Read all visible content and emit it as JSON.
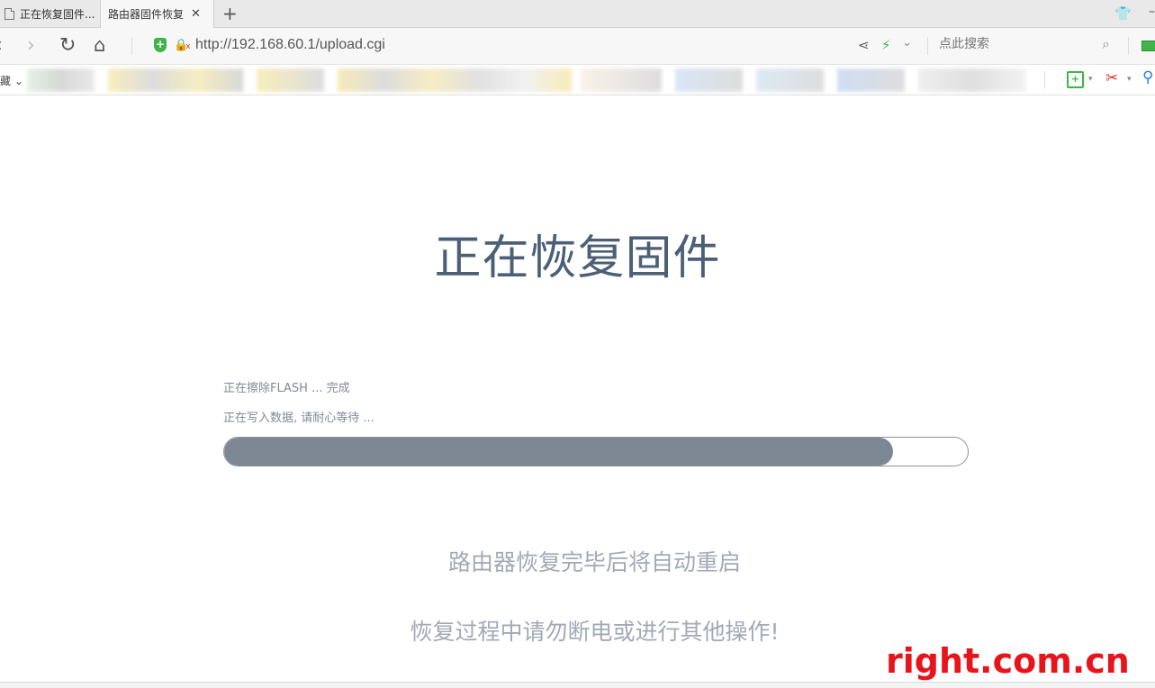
{
  "tabs": [
    {
      "label": "正在恢复固件...",
      "active": false
    },
    {
      "label": "路由器固件恢复",
      "active": true
    }
  ],
  "address_bar": {
    "url": "http://192.168.60.1/upload.cgi",
    "search_placeholder": "点此搜索"
  },
  "bookmarks_bar": {
    "label": "藏 ⌄"
  },
  "main": {
    "heading": "正在恢复固件",
    "status_lines": [
      "正在擦除FLASH ... 完成",
      "正在写入数据, 请耐心等待 ..."
    ],
    "progress": 0.9,
    "notes": [
      "路由器恢复完毕后将自动重启",
      "恢复过程中请勿断电或进行其他操作!"
    ]
  },
  "watermark": "right.com.cn",
  "colors": {
    "heading": "#4b6077",
    "progress_fill": "#7d8894",
    "watermark": "#e8141b",
    "accent_green": "#3fb549"
  }
}
